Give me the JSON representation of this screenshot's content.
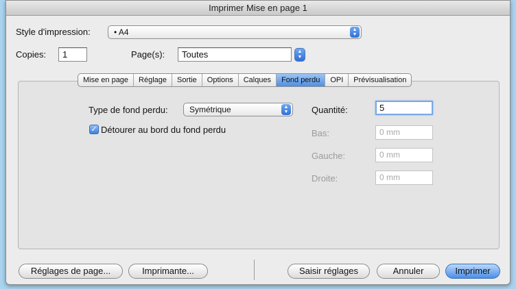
{
  "window": {
    "title": "Imprimer Mise en page 1"
  },
  "style": {
    "label": "Style d'impression:",
    "value": "• A4"
  },
  "copies": {
    "label": "Copies:",
    "value": "1"
  },
  "pages": {
    "label": "Page(s):",
    "value": "Toutes"
  },
  "tabs": [
    {
      "label": "Mise en page"
    },
    {
      "label": "Réglage"
    },
    {
      "label": "Sortie"
    },
    {
      "label": "Options"
    },
    {
      "label": "Calques"
    },
    {
      "label": "Fond perdu",
      "active": true
    },
    {
      "label": "OPI"
    },
    {
      "label": "Prévisualisation"
    }
  ],
  "bleed": {
    "type_label": "Type de fond perdu:",
    "type_value": "Symétrique",
    "clip_label": "Détourer au bord du fond perdu",
    "clip_checked": true,
    "quantity_label": "Quantité:",
    "quantity_value": "5",
    "bottom_label": "Bas:",
    "bottom_value": "0 mm",
    "left_label": "Gauche:",
    "left_value": "0 mm",
    "right_label": "Droite:",
    "right_value": "0 mm"
  },
  "buttons": {
    "page_setup": "Réglages de page...",
    "printer": "Imprimante...",
    "capture": "Saisir réglages",
    "cancel": "Annuler",
    "print": "Imprimer"
  },
  "colors": {
    "accent": "#4f8fe2",
    "desktop": "#a9d3ee"
  }
}
